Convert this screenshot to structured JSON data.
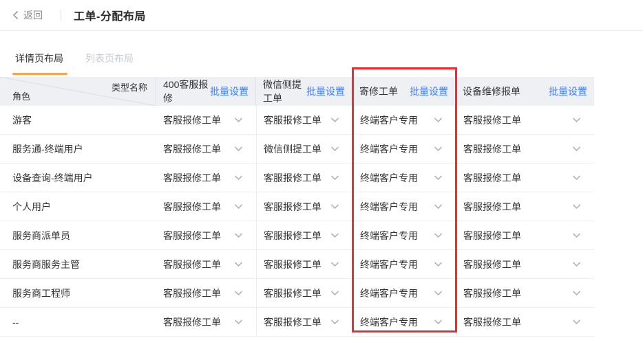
{
  "topbar": {
    "back_label": "返回",
    "title": "工单-分配布局"
  },
  "tabs": [
    {
      "label": "详情页布局",
      "active": true
    },
    {
      "label": "列表页布局",
      "active": false
    }
  ],
  "table": {
    "corner": {
      "type_label": "类型名称",
      "role_label": "角色"
    },
    "batch_label": "批量设置",
    "columns": [
      {
        "label": "400客服报修",
        "highlighted": false
      },
      {
        "label": "微信侧提工单",
        "highlighted": false
      },
      {
        "label": "寄修工单",
        "highlighted": true
      },
      {
        "label": "设备维修报单",
        "highlighted": false
      }
    ],
    "rows": [
      {
        "role": "游客",
        "values": [
          "客服报修工单",
          "客服报修工单",
          "终端客户专用",
          "客服报修工单"
        ]
      },
      {
        "role": "服务通-终端用户",
        "values": [
          "客服报修工单",
          "微信侧提工单",
          "终端客户专用",
          "客服报修工单"
        ]
      },
      {
        "role": "设备查询-终端用户",
        "values": [
          "客服报修工单",
          "客服报修工单",
          "终端客户专用",
          "客服报修工单"
        ]
      },
      {
        "role": "个人用户",
        "values": [
          "客服报修工单",
          "客服报修工单",
          "终端客户专用",
          "客服报修工单"
        ]
      },
      {
        "role": "服务商派单员",
        "values": [
          "客服报修工单",
          "客服报修工单",
          "终端客户专用",
          "客服报修工单"
        ]
      },
      {
        "role": "服务商服务主管",
        "values": [
          "客服报修工单",
          "客服报修工单",
          "终端客户专用",
          "客服报修工单"
        ]
      },
      {
        "role": "服务商工程师",
        "values": [
          "客服报修工单",
          "客服报修工单",
          "终端客户专用",
          "客服报修工单"
        ]
      },
      {
        "role": "--",
        "values": [
          "客服报修工单",
          "客服报修工单",
          "终端客户专用",
          "客服报修工单"
        ]
      }
    ]
  },
  "icons": {
    "back": "chevron-left",
    "dropdown": "chevron-down"
  },
  "colors": {
    "accent_orange": "#F5A64A",
    "link_blue": "#3D7EFA",
    "highlight_red": "#F12B30",
    "header_bg": "#EEF0F4"
  }
}
